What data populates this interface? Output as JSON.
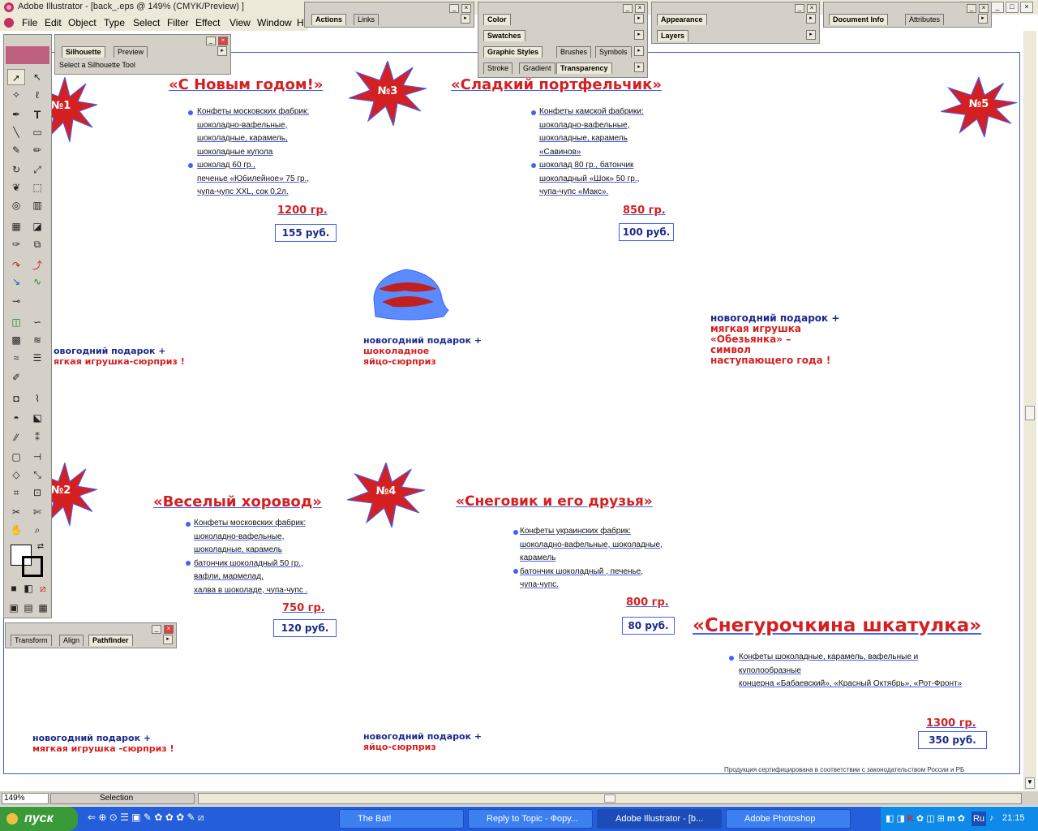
{
  "window": {
    "title": "Adobe Illustrator - [back_.eps @ 149% (CMYK/Preview) ]"
  },
  "menu": [
    "File",
    "Edit",
    "Object",
    "Type",
    "Select",
    "Filter",
    "Effect",
    "View",
    "Window",
    "He"
  ],
  "palettes": {
    "actions": {
      "tabs": [
        "Actions",
        "Links"
      ]
    },
    "color": {
      "tabs": [
        "Color"
      ],
      "swatches": "Swatches",
      "graphic_styles": [
        "Graphic Styles",
        "Brushes",
        "Symbols"
      ],
      "stroke": [
        "Stroke",
        "Gradient",
        "Transparency"
      ]
    },
    "appearance": {
      "tabs": [
        "Appearance"
      ],
      "layers": "Layers"
    },
    "docinfo": {
      "tabs": [
        "Document Info",
        "Attributes"
      ]
    },
    "silhouette": {
      "tabs": [
        "Silhouette",
        "Preview"
      ],
      "text": "Select a Silhouette Tool"
    },
    "pathfinder": {
      "tabs": [
        "Transform",
        "Align",
        "Pathfinder"
      ]
    }
  },
  "artwork": {
    "stars": [
      {
        "label": "№1"
      },
      {
        "label": "№3"
      },
      {
        "label": "№5"
      },
      {
        "label": "№2"
      },
      {
        "label": "№4"
      }
    ],
    "sets": [
      {
        "title": "«С Новым годом!»",
        "items": [
          "Конфеты московских фабрик:",
          "шоколадно-вафельные,",
          "шоколадные, карамель,",
          "шоколадные купола",
          "шоколад 60 гр.,",
          "печенье «Юбилейное» 75 гр.,",
          "чупа-чупс XXL, сок 0,2л."
        ],
        "weight": "1200 гр.",
        "price": "155 руб."
      },
      {
        "title": "«Сладкий портфельчик»",
        "items": [
          "Конфеты камской фабрики:",
          "шоколадно-вафельные,",
          "шоколадные, карамель",
          "«Савинов»",
          "шоколад 80 гр., батончик",
          "шоколадный «Шок» 50 гр.,",
          "чупа-чупс «Макс»."
        ],
        "weight": "850 гр.",
        "price": "100 руб."
      },
      {
        "title": "«Веселый хоровод»",
        "items": [
          "Конфеты московских фабрик:",
          "шоколадно-вафельные,",
          "шоколадные, карамель",
          "батончик шоколадный 50 гр.,",
          "вафли, мармелад,",
          "халва в шоколаде, чупа-чупс ."
        ],
        "weight": "750 гр.",
        "price": "120 руб."
      },
      {
        "title": "«Снеговик и его друзья»",
        "items": [
          "Конфеты украинских фабрик:",
          "шоколадно-вафельные, шоколадные,",
          "карамель",
          "батончик шоколадный , печенье,",
          "чупа-чупс."
        ],
        "weight": "800 гр.",
        "price": "80 руб."
      },
      {
        "title": "«Снегурочкина шкатулка»",
        "items": [
          "Конфеты шоколадные, карамель, вафельные и",
          "куполообразные",
          "концерна «Бабаевский», «Красный Октябрь», «Рот-Фронт»"
        ],
        "weight": "1300 гр.",
        "price": "350 руб."
      }
    ],
    "gifts": [
      {
        "blue": "новогодний подарок +",
        "red": [
          "шоколадное",
          "яйцо-сюрприз"
        ]
      },
      {
        "blue": "новогодний подарок +",
        "red": [
          "мягкая игрушка",
          "«Обезьянка» –",
          "символ",
          "наступающего года !"
        ]
      },
      {
        "blue": "овогодний подарок +",
        "red": [
          "ягкая игрушка-сюрприз !"
        ]
      },
      {
        "blue": "новогодний подарок +",
        "red": [
          "мягкая игрушка -сюрприз !"
        ]
      },
      {
        "blue": "новогодний подарок +",
        "red": [
          "яйцо-сюрприз"
        ]
      }
    ],
    "footnote": "Продукция сертифицирована в соответствии с законодательством России и РБ"
  },
  "status": {
    "zoom": "149%",
    "mode": "Selection"
  },
  "taskbar": {
    "start": "пуск",
    "tasks": [
      "The Bat!",
      "Reply to Topic - Фору...",
      "Adobe Illustrator - [b...",
      "Adobe Photoshop"
    ],
    "lang": "Ru",
    "clock": "21:15"
  }
}
